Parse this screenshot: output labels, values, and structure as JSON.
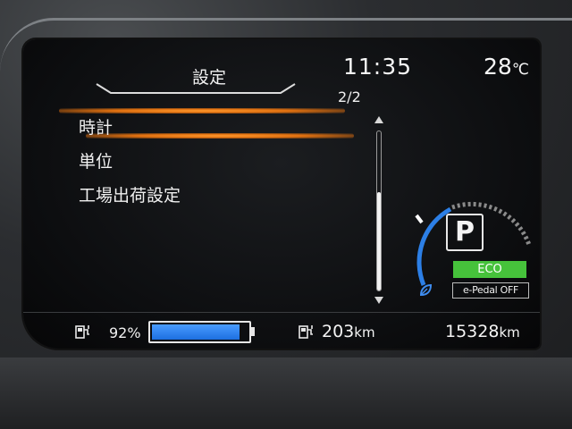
{
  "header": {
    "menu_title": "設定",
    "clock": "11:35",
    "temperature_value": "28",
    "temperature_unit": "℃",
    "page_indicator": "2/2"
  },
  "menu": {
    "items": [
      {
        "label": "時計",
        "selected": true
      },
      {
        "label": "単位",
        "selected": false
      },
      {
        "label": "工場出荷設定",
        "selected": false
      }
    ]
  },
  "scrollbar": {
    "thumb_fraction": 0.62
  },
  "status": {
    "gear": "P",
    "eco_label": "ECO",
    "epedal_label": "e-Pedal OFF"
  },
  "bottom": {
    "battery_percent": "92%",
    "battery_level": 0.92,
    "range_value": "203",
    "range_unit": "km",
    "odometer_value": "15328",
    "odometer_unit": "km"
  },
  "colors": {
    "highlight": "#ff9a2e",
    "battery": "#2f86f0",
    "eco_badge": "#46c23b",
    "gauge_blue": "#2c7fe6"
  }
}
